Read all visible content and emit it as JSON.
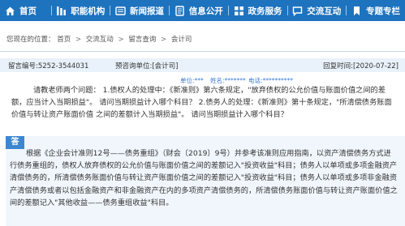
{
  "nav": {
    "items": [
      {
        "label": "首页",
        "icon": "home-icon"
      },
      {
        "label": "职能机构",
        "icon": "org-chart-icon"
      },
      {
        "label": "新闻报道",
        "icon": "news-icon"
      },
      {
        "label": "信息公开",
        "icon": "document-icon"
      },
      {
        "label": "政务服务",
        "icon": "service-grid-icon"
      },
      {
        "label": "交流互动",
        "icon": "chat-icon"
      },
      {
        "label": "专题专栏",
        "icon": "bookmark-icon"
      }
    ],
    "colors": {
      "background": "#1e73be",
      "text": "#ffffff"
    }
  },
  "breadcrumb": {
    "prefix": "您现在的位置：",
    "items": [
      "首页",
      "交流互动",
      "留言查询",
      "会计司"
    ],
    "separator": ">"
  },
  "message": {
    "number": "留言编号:5252-3544031",
    "unit": "预咨询单位:[会计司]",
    "reply_time": "回复时间:[2020-07-22]",
    "unit_line": "单位:***",
    "name_line": "姓名:*******",
    "phone_line": "电话:**********",
    "question": "请教老师两个问题： 1.债权人的处理中：《新准则》第六条规定，\"放弃债权的公允价值与账面价值之间的差额，应当计入当期损益\"。 请问当期损益计入哪个科目？ 2.债务人的处理：《新准则》第十条规定，\"所清偿债务账面价值与转让资产账面价值 之间的差额计入当期损益\"。 请问当期损益计入哪个科目？"
  },
  "answer": {
    "tag": "答",
    "text": "根据《企业会计准则12号——债务重组》（财会〔2019〕9号）并参考该准则应用指南，以资产清偿债务方式进行债务重组的，债权人放弃债权的公允价值与账面价值之间的差额记入\"投资收益\"科目；债务人以单项或多项金融资产清偿债务的，所清偿债务账面价值与转让资产账面价值之间的差额记入\"投资收益\"科目；债务人以单项或多项非金融资产清偿债务或者以包括金融资产和非金融资产在内的多项资产清偿债务的，所清偿债务账面价值与转让资产账面价值之间的差额记入\"其他收益——债务重组收益\"科目。"
  }
}
